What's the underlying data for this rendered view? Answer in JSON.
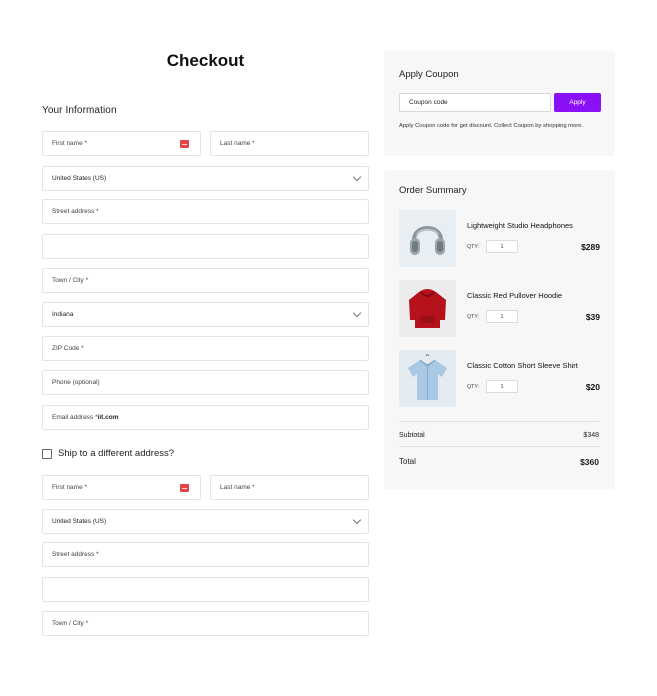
{
  "page": {
    "title": "Checkout"
  },
  "billing": {
    "section_title": "Your Information",
    "first_name": "First name *",
    "last_name": "Last name *",
    "country": "United States (US)",
    "street": "Street address *",
    "street2": "",
    "city": "Town / City *",
    "state": "Indiana",
    "zip": "ZIP Code *",
    "phone": "Phone (optional)",
    "email_label": "Email address *",
    "email_value": "iit.com"
  },
  "ship_different": {
    "label": "Ship to a different address?",
    "checked": false
  },
  "shipping": {
    "first_name": "First name *",
    "last_name": "Last name *",
    "country": "United States (US)",
    "street": "Street address *",
    "street2": "",
    "city": "Town / City *"
  },
  "coupon": {
    "title": "Apply Coupon",
    "placeholder": "Coupon code",
    "apply_label": "Apply",
    "help_text": "Apply Coupon code for get discount. Collect Coupon by shopping more."
  },
  "summary": {
    "title": "Order Summary",
    "qty_label": "QTY:",
    "items": [
      {
        "name": "Lightweight Studio Headphones",
        "qty": "1",
        "price": "$289",
        "icon": "headphones-icon"
      },
      {
        "name": "Classic Red Pullover Hoodie",
        "qty": "1",
        "price": "$39",
        "icon": "hoodie-icon"
      },
      {
        "name": "Classic Cotton Short Sleeve Shirt",
        "qty": "1",
        "price": "$20",
        "icon": "shirt-icon"
      }
    ],
    "subtotal_label": "Subtotal",
    "subtotal_value": "$348",
    "total_label": "Total",
    "total_value": "$360"
  },
  "colors": {
    "accent": "#8a10f5",
    "panel": "#f7f7f7",
    "border": "#e4e4e4",
    "badge": "#e24545"
  }
}
